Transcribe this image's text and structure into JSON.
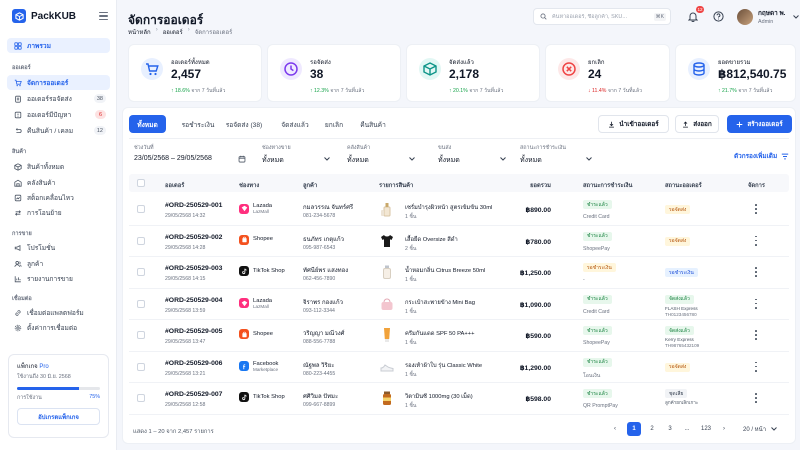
{
  "app": {
    "logo": "PackKUB"
  },
  "sidebar": {
    "overview": "ภาพรวม",
    "sections": [
      "ออเดอร์",
      "สินค้า",
      "การขาย",
      "เชื่อมต่อ"
    ],
    "items": [
      {
        "label": "จัดการออเดอร์",
        "badge": ""
      },
      {
        "label": "ออเดอร์รอจัดส่ง",
        "badge": "38"
      },
      {
        "label": "ออเดอร์มีปัญหา",
        "badge": "6"
      },
      {
        "label": "คืนสินค้า / เคลม",
        "badge": "12"
      },
      {
        "label": "สินค้าทั้งหมด",
        "badge": ""
      },
      {
        "label": "คลังสินค้า",
        "badge": ""
      },
      {
        "label": "สต็อกเคลื่อนไหว",
        "badge": ""
      },
      {
        "label": "การโอนย้าย",
        "badge": ""
      },
      {
        "label": "โปรโมชั่น",
        "badge": ""
      },
      {
        "label": "ลูกค้า",
        "badge": ""
      },
      {
        "label": "รายงานการขาย",
        "badge": ""
      },
      {
        "label": "เชื่อมต่อแพลตฟอร์ม",
        "badge": ""
      },
      {
        "label": "ตั้งค่าการเชื่อมต่อ",
        "badge": ""
      }
    ],
    "plan": {
      "title": "แพ็กเกจ",
      "name": "Pro",
      "expiry": "ใช้งานถึง 30 มิ.ย. 2568",
      "usage_label": "การใช้งาน",
      "usage_value": "75%",
      "usage": 0.75,
      "button": "อัปเกรดแพ็กเกจ"
    }
  },
  "header": {
    "title": "จัดการออเดอร์",
    "breadcrumb": [
      "หน้าหลัก",
      "ออเดอร์",
      "จัดการออเดอร์"
    ],
    "search_placeholder": "ค้นหาออเดอร์, ชื่อลูกค้า, SKU...",
    "search_shortcut": "⌘K",
    "notifications": "12",
    "user_name": "กฤษดา พ.",
    "user_role": "Admin"
  },
  "stats": [
    {
      "label": "ออเดอร์ทั้งหมด",
      "value": "2,457",
      "trend": "↑ 18.6%",
      "trend_dir": "up",
      "compare": "จาก 7 วันที่แล้ว",
      "color": "#2563eb",
      "bg": "#e8f0ff",
      "icon": "cart-icon"
    },
    {
      "label": "รอจัดส่ง",
      "value": "38",
      "trend": "↑ 12.3%",
      "trend_dir": "up",
      "compare": "จาก 7 วันที่แล้ว",
      "color": "#7c3aed",
      "bg": "#efe9ff",
      "icon": "clock-icon"
    },
    {
      "label": "จัดส่งแล้ว",
      "value": "2,178",
      "trend": "↑ 20.1%",
      "trend_dir": "up",
      "compare": "จาก 7 วันที่แล้ว",
      "color": "#0d9488",
      "bg": "#e2f7f4",
      "icon": "box-icon"
    },
    {
      "label": "ยกเลิก",
      "value": "24",
      "trend": "↓ 11.4%",
      "trend_dir": "down",
      "compare": "จาก 7 วันที่แล้ว",
      "color": "#ef4444",
      "bg": "#fde8e8",
      "icon": "cancel-icon"
    },
    {
      "label": "ยอดขายรวม",
      "value": "฿812,540.75",
      "trend": "↑ 21.7%",
      "trend_dir": "up",
      "compare": "จาก 7 วันที่แล้ว",
      "color": "#2563eb",
      "bg": "#e8f0ff",
      "icon": "coins-icon"
    }
  ],
  "tabs": [
    "ทั้งหมด",
    "รอชำระเงิน",
    "รอจัดส่ง (38)",
    "จัดส่งแล้ว",
    "ยกเลิก",
    "คืนสินค้า"
  ],
  "actions": {
    "import": "นำเข้าออเดอร์",
    "export": "ส่งออก",
    "create": "สร้างออเดอร์"
  },
  "filters": [
    {
      "label": "ช่วงวันที่",
      "value": "23/05/2568 – 29/05/2568"
    },
    {
      "label": "ช่องทางขาย",
      "value": "ทั้งหมด"
    },
    {
      "label": "คลังสินค้า",
      "value": "ทั้งหมด"
    },
    {
      "label": "ขนส่ง",
      "value": "ทั้งหมด"
    },
    {
      "label": "สถานะการชำระเงิน",
      "value": "ทั้งหมด"
    }
  ],
  "more_filters": "ตัวกรองเพิ่มเติม",
  "table": {
    "headers": [
      "ออเดอร์",
      "ช่องทาง",
      "ลูกค้า",
      "รายการสินค้า",
      "ยอดรวม",
      "สถานะการชำระเงิน",
      "สถานะออเดอร์",
      "จัดการ"
    ],
    "rows": [
      {
        "id": "#ORD-250529-001",
        "date": "29/05/2568 14:32",
        "channel": "Lazada",
        "channel_sub": "LazMall",
        "customer": "กมลวรรณ จันทร์ศรี",
        "phone": "081-234-5678",
        "product": "เซรั่มบำรุงผิวหน้า สูตรเข้มข้น 30ml",
        "qty": "1 ชิ้น",
        "total": "฿890.00",
        "pay_status": "ชำระแล้ว",
        "pay_method": "Credit Card",
        "order_status": "รอจัดส่ง",
        "ship_name": "",
        "ship_code": ""
      },
      {
        "id": "#ORD-250529-002",
        "date": "29/05/2568 14:28",
        "channel": "Shopee",
        "channel_sub": "",
        "customer": "ธนภัทร เกตุแก้ว",
        "phone": "095-987-6543",
        "product": "เสื้อยืด Oversize สีดำ",
        "qty": "2 ชิ้น",
        "total": "฿780.00",
        "pay_status": "ชำระแล้ว",
        "pay_method": "ShopeePay",
        "order_status": "รอจัดส่ง",
        "ship_name": "",
        "ship_code": ""
      },
      {
        "id": "#ORD-250529-003",
        "date": "29/05/2568 14:15",
        "channel": "TikTok Shop",
        "channel_sub": "",
        "customer": "ทัศนีย์พร แสงทอง",
        "phone": "062-456-7890",
        "product": "น้ำหอมกลิ่น Citrus Breeze 50ml",
        "qty": "1 ชิ้น",
        "total": "฿1,250.00",
        "pay_status": "รอชำระเงิน",
        "pay_method": "-",
        "order_status": "รอชำระเงิน",
        "ship_name": "",
        "ship_code": ""
      },
      {
        "id": "#ORD-250529-004",
        "date": "29/05/2568 13:59",
        "channel": "Lazada",
        "channel_sub": "LazMall",
        "customer": "จิราพร กองแก้ว",
        "phone": "093-112-3344",
        "product": "กระเป๋าสะพายข้าง Mini Bag",
        "qty": "1 ชิ้น",
        "total": "฿1,090.00",
        "pay_status": "ชำระแล้ว",
        "pay_method": "Credit Card",
        "order_status": "จัดส่งแล้ว",
        "ship_name": "FLASH Express",
        "ship_code": "TH0123456780"
      },
      {
        "id": "#ORD-250529-005",
        "date": "29/05/2568 13:47",
        "channel": "Shopee",
        "channel_sub": "",
        "customer": "วริญญา มณีวงศ์",
        "phone": "088-556-7788",
        "product": "ครีมกันแดด SPF 50 PA+++",
        "qty": "1 ชิ้น",
        "total": "฿590.00",
        "pay_status": "ชำระแล้ว",
        "pay_method": "ShopeePay",
        "order_status": "จัดส่งแล้ว",
        "ship_name": "Kerry Express",
        "ship_code": "TH98765432109"
      },
      {
        "id": "#ORD-250529-006",
        "date": "29/05/2568 13:21",
        "channel": "Facebook",
        "channel_sub": "Marketplace",
        "customer": "ณัฐพล วิริยะ",
        "phone": "080-223-4455",
        "product": "รองเท้าผ้าใบ รุ่น Classic White",
        "qty": "1 ชิ้น",
        "total": "฿1,290.00",
        "pay_status": "ชำระแล้ว",
        "pay_method": "โอนเงิน",
        "order_status": "รอจัดส่ง",
        "ship_name": "",
        "ship_code": ""
      },
      {
        "id": "#ORD-250529-007",
        "date": "29/05/2568 12:58",
        "channel": "TikTok Shop",
        "channel_sub": "",
        "customer": "ศศิวิมล ปัทมะ",
        "phone": "099-667-8899",
        "product": "วิตามินซี 1000mg (30 เม็ด)",
        "qty": "1 ชิ้น",
        "total": "฿598.00",
        "pay_status": "ชำระแล้ว",
        "pay_method": "QR PromptPay",
        "order_status": "ชุดเสีย",
        "ship_name": "",
        "ship_code": "ลูกค้ายกเลิกเกาะ"
      }
    ]
  },
  "pagination": {
    "summary": "แสดง 1 – 20 จาก 2,457 รายการ",
    "pages": [
      "1",
      "2",
      "3",
      "...",
      "123"
    ],
    "per_page": "20 / หน้า"
  }
}
